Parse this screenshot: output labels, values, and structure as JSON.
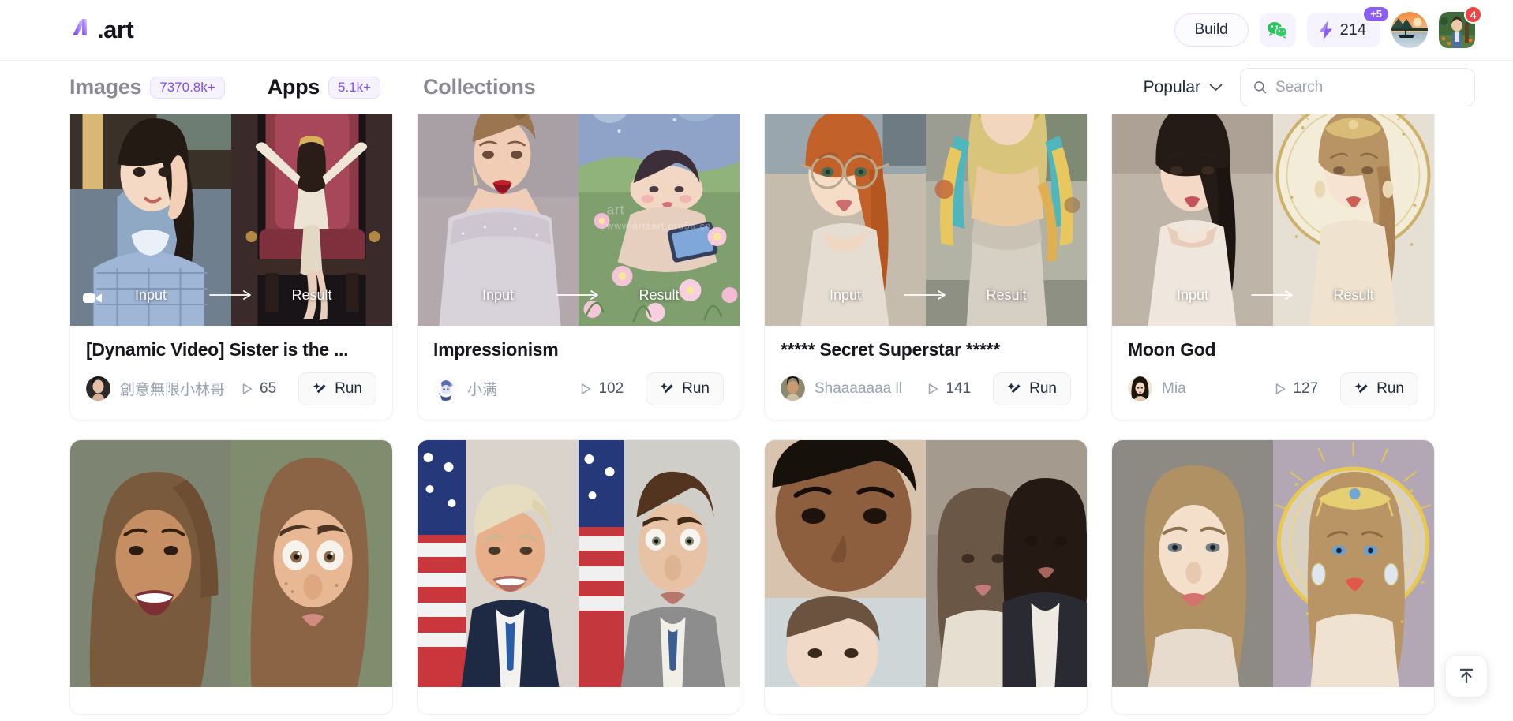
{
  "header": {
    "logo_text": ".art",
    "build_label": "Build",
    "wechat_icon": "wechat-icon",
    "credits": {
      "value": "214",
      "bonus_badge": "+5",
      "icon": "lightning-bolt-icon"
    },
    "profile_avatar": "landscape-boat-avatar",
    "notifications_badge": "4"
  },
  "subnav": {
    "tabs": [
      {
        "label": "Images",
        "badge": "7370.8k+",
        "active": false
      },
      {
        "label": "Apps",
        "badge": "5.1k+",
        "active": true
      },
      {
        "label": "Collections",
        "badge": "",
        "active": false
      }
    ],
    "sort": {
      "value": "Popular",
      "icon": "chevron-down-icon"
    },
    "search": {
      "value": "",
      "placeholder": "Search",
      "icon": "search-icon"
    }
  },
  "grid": {
    "overlay": {
      "input_label": "Input",
      "result_label": "Result",
      "arrow_icon": "arrow-right-icon"
    },
    "run_label": "Run",
    "run_icon": "magic-wand-icon",
    "plays_icon": "play-triangle-icon",
    "cards": [
      {
        "title": "[Dynamic Video] Sister is the ...",
        "author": "創意無限小林哥",
        "plays": "65",
        "is_video": true,
        "watermark": "",
        "input_label": "Input",
        "result_label": "Result"
      },
      {
        "title": "Impressionism",
        "author": "小满",
        "plays": "102",
        "is_video": false,
        "watermark": "art",
        "watermark_sub": "www.artsart.pro5a.cn",
        "input_label": "Input",
        "result_label": "Result"
      },
      {
        "title": "***** Secret Superstar *****",
        "author": "Shaaaaaaa ll",
        "plays": "141",
        "is_video": false,
        "watermark": "",
        "input_label": "Input",
        "result_label": "Result"
      },
      {
        "title": "Moon God",
        "author": "Mia",
        "plays": "127",
        "is_video": false,
        "watermark": "",
        "input_label": "Input",
        "result_label": "Result"
      }
    ]
  },
  "to_top": {
    "icon": "arrow-up-to-line-icon"
  }
}
